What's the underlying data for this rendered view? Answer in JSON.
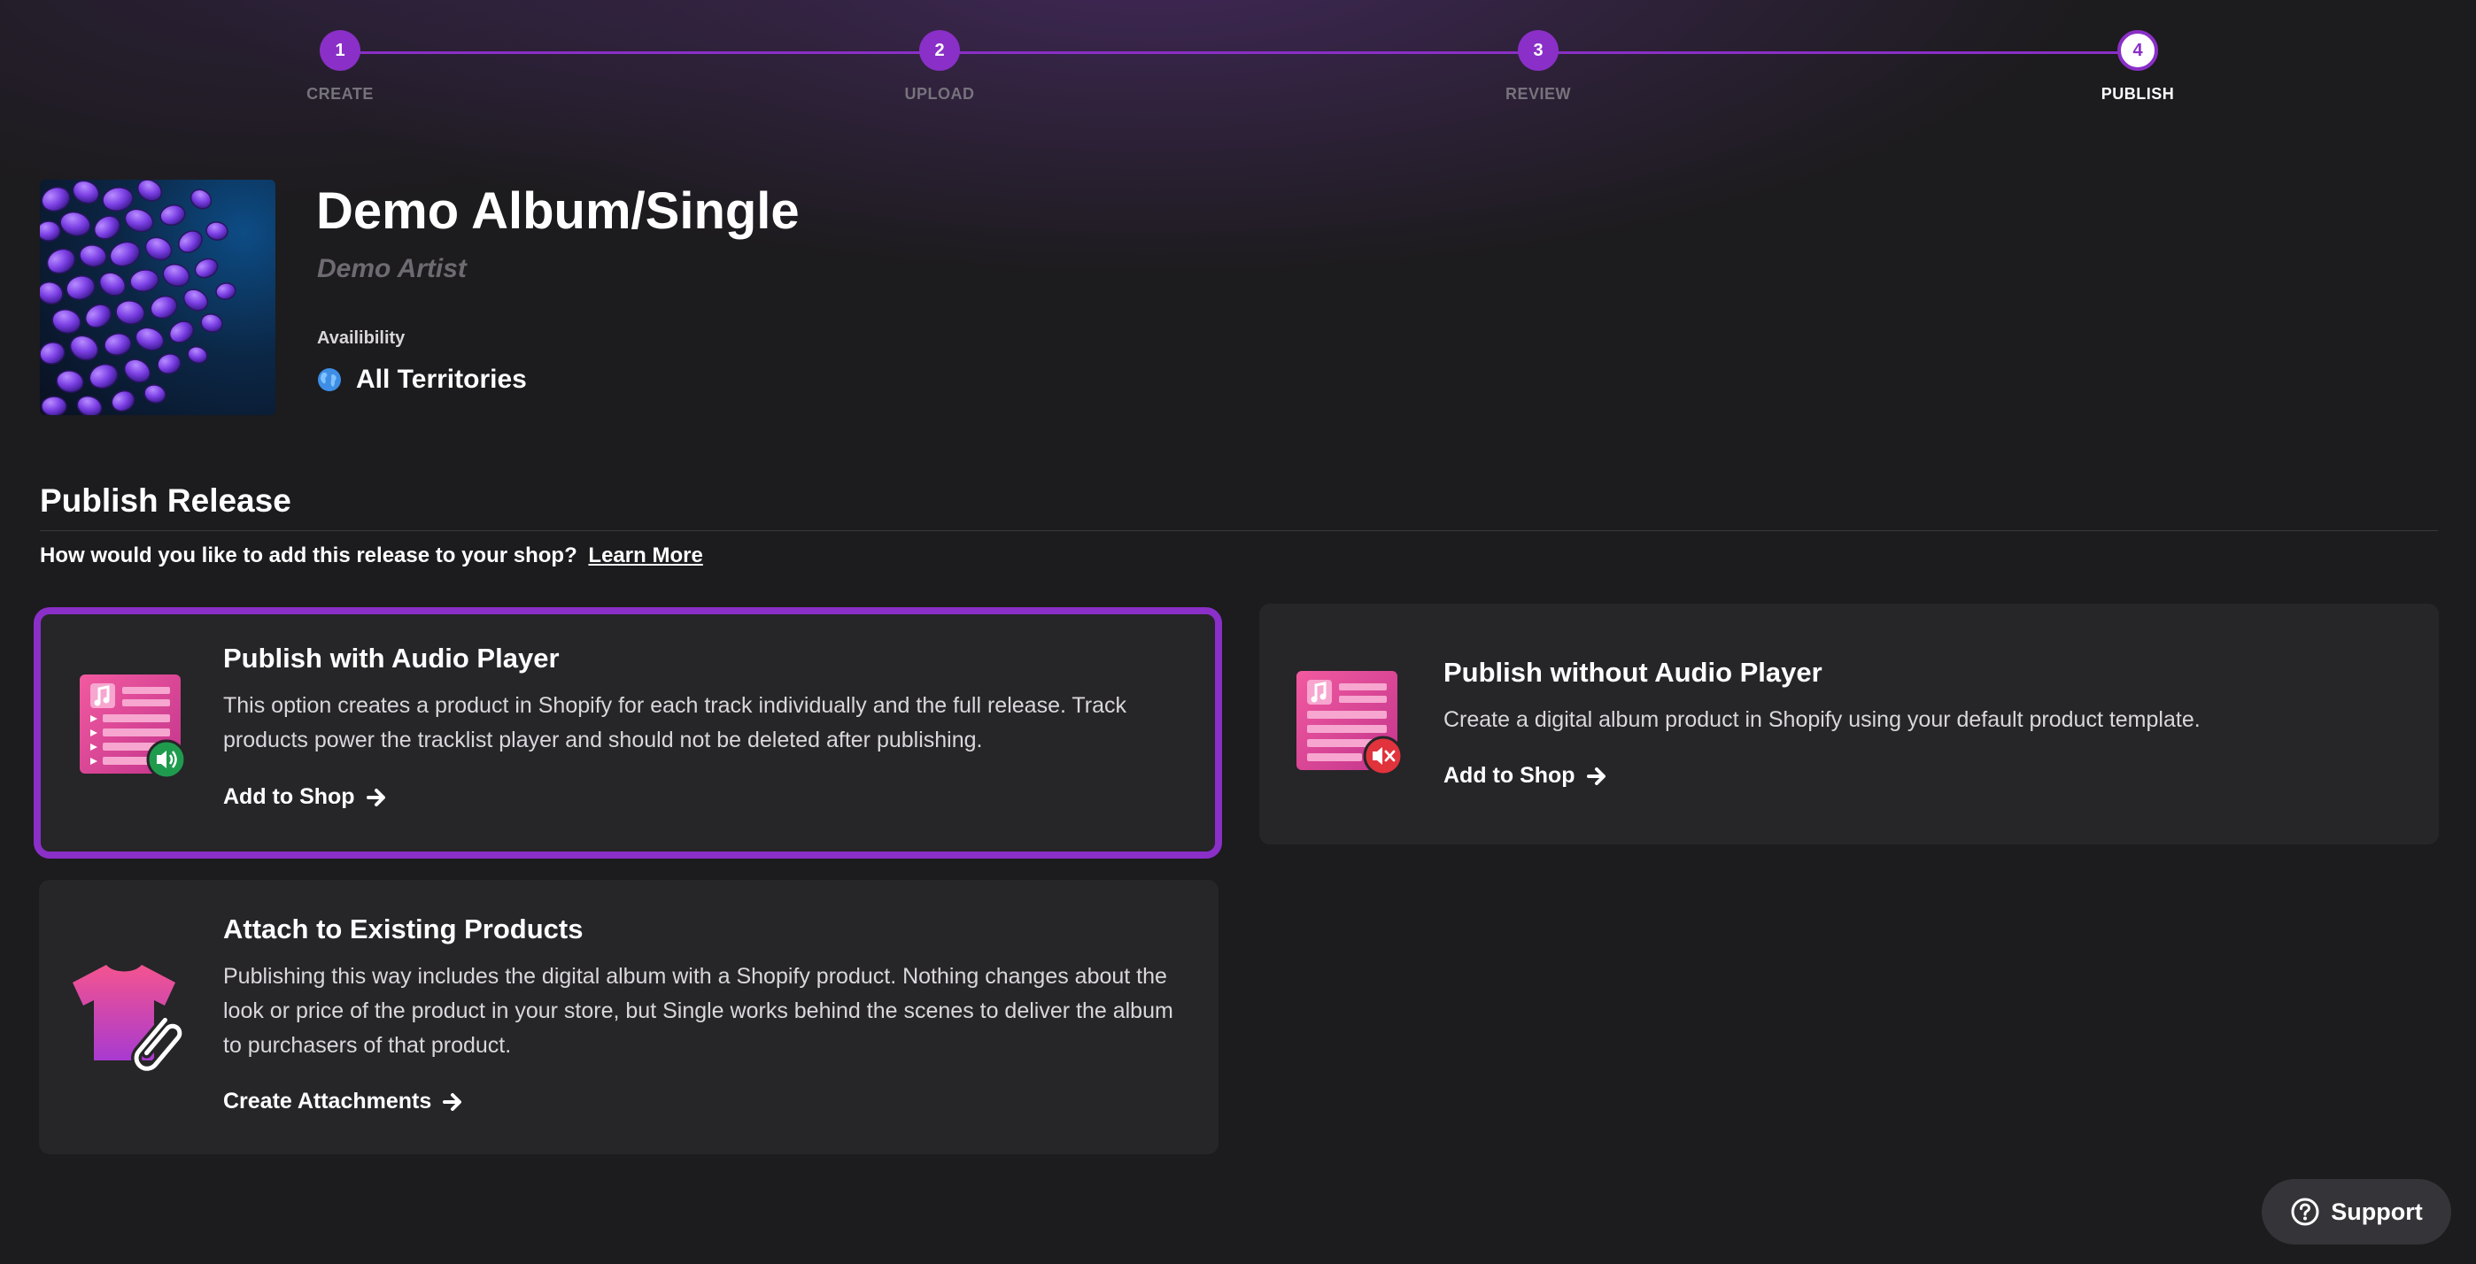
{
  "stepper": {
    "steps": [
      {
        "number": "1",
        "label": "CREATE"
      },
      {
        "number": "2",
        "label": "UPLOAD"
      },
      {
        "number": "3",
        "label": "REVIEW"
      },
      {
        "number": "4",
        "label": "PUBLISH"
      }
    ],
    "active_step": 4
  },
  "release": {
    "title": "Demo Album/Single",
    "artist": "Demo Artist",
    "availability_label": "Availibility",
    "availability_value": "All Territories"
  },
  "publish": {
    "section_title": "Publish Release",
    "question": "How would you like to add this release to your shop?",
    "learn_more": "Learn More",
    "options": [
      {
        "title": "Publish with Audio Player",
        "description": "This option creates a product in Shopify for each track individually and the full release. Track products power the tracklist player and should not be deleted after publishing.",
        "action": "Add to Shop",
        "icon": "tracklist-audio-on-icon",
        "selected": true
      },
      {
        "title": "Publish without Audio Player",
        "description": "Create a digital album product in Shopify using your default product template.",
        "action": "Add to Shop",
        "icon": "tracklist-audio-off-icon",
        "selected": false
      },
      {
        "title": "Attach to Existing Products",
        "description": "Publishing this way includes the digital album with a Shopify product. Nothing changes about the look or price of the product in your store, but Single works behind the scenes to deliver the album to purchasers of that product.",
        "action": "Create Attachments",
        "icon": "tshirt-paperclip-icon",
        "selected": false
      }
    ]
  },
  "support": {
    "label": "Support",
    "icon": "question-circle-icon"
  },
  "colors": {
    "accent": "#8a2fc7",
    "background": "#1c1b1d",
    "card": "#262528",
    "audio_on_badge": "#1f9b4e",
    "audio_off_badge": "#e0333c"
  }
}
